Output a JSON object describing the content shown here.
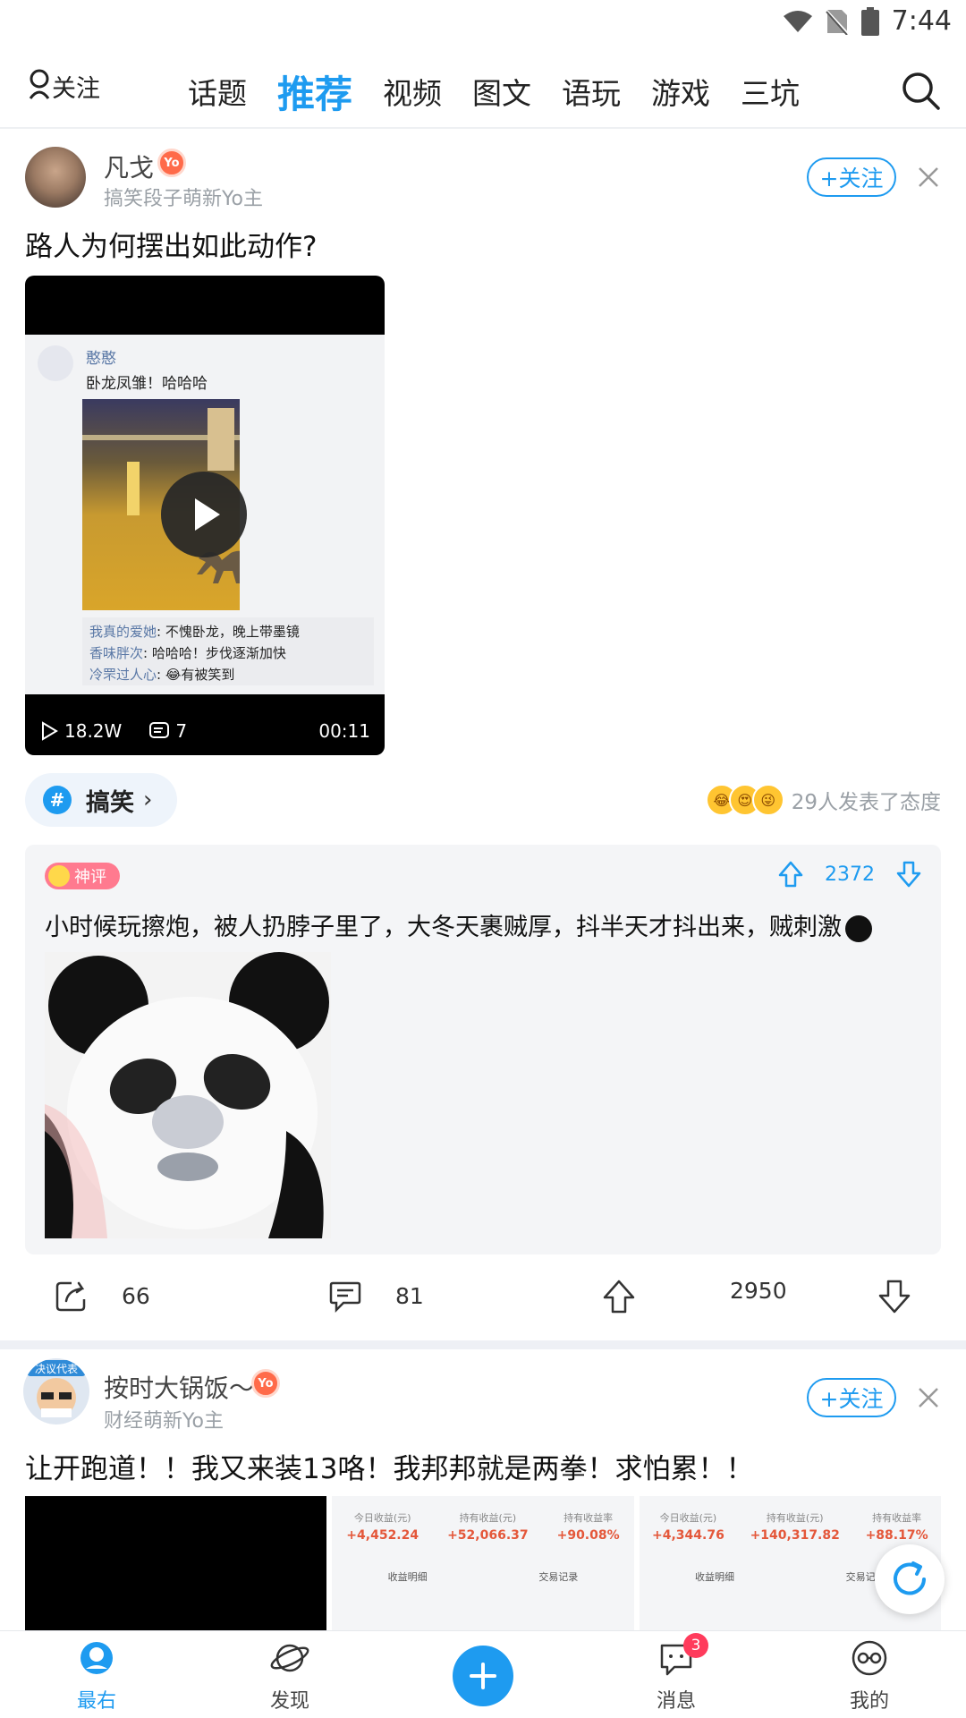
{
  "status_bar": {
    "time": "7:44"
  },
  "top_nav": {
    "follow_label": "关注",
    "tabs": [
      "话题",
      "推荐",
      "视频",
      "图文",
      "语玩",
      "游戏",
      "三坑"
    ],
    "active_tab": "推荐"
  },
  "post1": {
    "author": "凡戈",
    "badge": "Yo",
    "subtitle": "搞笑段子萌新Yo主",
    "follow_label": "+关注",
    "title": "路人为何摆出如此动作?",
    "video": {
      "inner_name": "憨憨",
      "inner_text": "卧龙凤雏！哈哈哈",
      "comments": [
        {
          "user": "我真的爱她",
          "text": ": 不愧卧龙，晚上带墨镜"
        },
        {
          "user": "香味胖次",
          "text": ": 哈哈哈！步伐逐渐加快"
        },
        {
          "user": "冷罘过人心",
          "text": ": 😂有被笑到"
        }
      ],
      "plays": "18.2W",
      "comment_count": "7",
      "duration": "00:11"
    },
    "topic": "搞笑",
    "attitude_text": "29人发表了态度",
    "god_comment": {
      "badge": "神评",
      "votes": "2372",
      "text": "小时候玩擦炮，被人扔脖子里了，大冬天裹贼厚，抖半天才抖出来，贼刺激"
    },
    "actions": {
      "shares": "66",
      "comments": "81",
      "votes": "2950"
    }
  },
  "post2": {
    "author": "按时大锅饭～",
    "badge": "Yo",
    "subtitle": "财经萌新Yo主",
    "follow_label": "+关注",
    "title": "让开跑道！！我又来装13咯！我邦邦就是两拳！求怕累！！",
    "avatar_caption": "决议代表",
    "images": [
      {
        "labels": [
          "今日收益(元)",
          "持有收益(元)",
          "持有收益率"
        ],
        "values": [
          "+4,452.24",
          "+52,066.37",
          "+90.08%"
        ],
        "links": [
          "收益明细",
          "交易记录"
        ]
      },
      {
        "labels": [
          "今日收益(元)",
          "持有收益(元)",
          "持有收益率"
        ],
        "values": [
          "+4,344.76",
          "+140,317.82",
          "+88.17%"
        ],
        "links": [
          "收益明细",
          "交易记录"
        ]
      }
    ]
  },
  "bottom_nav": {
    "items": [
      "最右",
      "发现",
      "消息",
      "我的"
    ],
    "message_badge": "3"
  },
  "colors": {
    "accent": "#1e9bf0",
    "badge": "#ff3b5c",
    "profit": "#e4573a"
  }
}
